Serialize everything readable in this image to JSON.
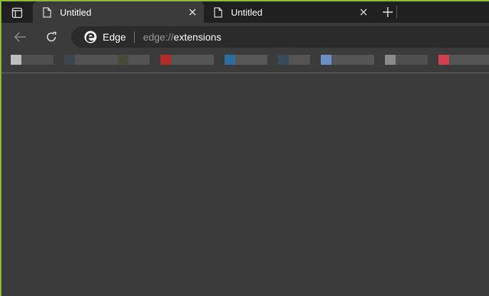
{
  "tabs": [
    {
      "title": "Untitled",
      "icon": "page-icon",
      "active": true
    },
    {
      "title": "Untitled",
      "icon": "page-icon",
      "active": false
    }
  ],
  "toolbar": {
    "back_icon": "back-arrow-icon",
    "refresh_icon": "refresh-icon"
  },
  "address_bar": {
    "site_label": "Edge",
    "url_scheme": "edge://",
    "url_path": "extensions"
  },
  "colors": {
    "accent_border": "#8bbf3a",
    "tabstrip_bg": "#1f1f1f",
    "window_bg": "#3b3b3b",
    "address_bg": "#2b2b2b"
  }
}
